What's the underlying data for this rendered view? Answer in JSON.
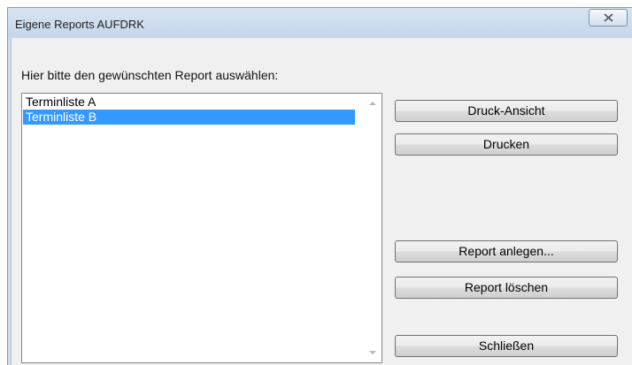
{
  "window": {
    "title": "Eigene Reports AUFDRK"
  },
  "dialog": {
    "prompt": "Hier bitte den gewünschten Report auswählen:",
    "reports": [
      {
        "label": "Terminliste A",
        "selected": false
      },
      {
        "label": "Terminliste B",
        "selected": true
      }
    ],
    "buttons": {
      "preview": "Druck-Ansicht",
      "print": "Drucken",
      "create": "Report anlegen...",
      "delete": "Report löschen",
      "close": "Schließen"
    }
  },
  "colors": {
    "selection": "#3399ff",
    "title_bar": "#cfdcea"
  },
  "icons": {
    "close": "close-x-icon",
    "scroll_up": "scroll-up-arrow-icon",
    "scroll_down": "scroll-down-arrow-icon"
  }
}
